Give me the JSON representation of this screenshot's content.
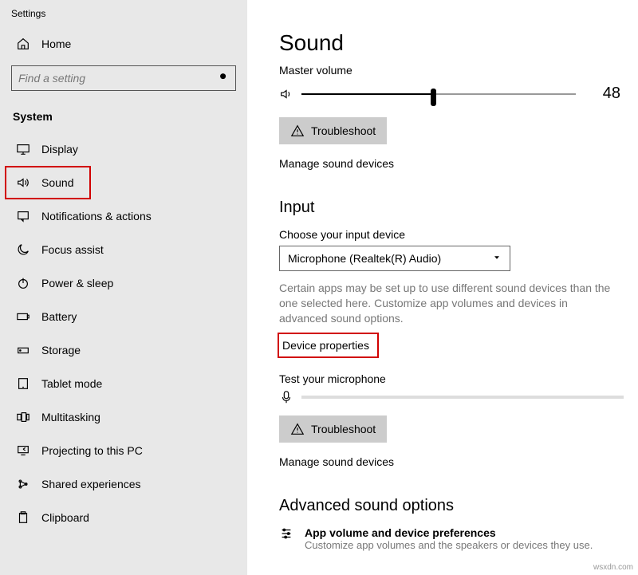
{
  "window_title": "Settings",
  "sidebar": {
    "home": "Home",
    "search_placeholder": "Find a setting",
    "section": "System",
    "items": [
      {
        "label": "Display",
        "icon": "display-icon"
      },
      {
        "label": "Sound",
        "icon": "sound-icon",
        "highlighted": true
      },
      {
        "label": "Notifications & actions",
        "icon": "notifications-icon"
      },
      {
        "label": "Focus assist",
        "icon": "focus-assist-icon"
      },
      {
        "label": "Power & sleep",
        "icon": "power-icon"
      },
      {
        "label": "Battery",
        "icon": "battery-icon"
      },
      {
        "label": "Storage",
        "icon": "storage-icon"
      },
      {
        "label": "Tablet mode",
        "icon": "tablet-icon"
      },
      {
        "label": "Multitasking",
        "icon": "multitasking-icon"
      },
      {
        "label": "Projecting to this PC",
        "icon": "projecting-icon"
      },
      {
        "label": "Shared experiences",
        "icon": "shared-icon"
      },
      {
        "label": "Clipboard",
        "icon": "clipboard-icon"
      }
    ]
  },
  "main": {
    "title": "Sound",
    "master_volume_label": "Master volume",
    "volume_value": "48",
    "troubleshoot": "Troubleshoot",
    "manage_devices": "Manage sound devices",
    "input_heading": "Input",
    "choose_input_label": "Choose your input device",
    "input_device": "Microphone (Realtek(R) Audio)",
    "input_desc": "Certain apps may be set up to use different sound devices than the one selected here. Customize app volumes and devices in advanced sound options.",
    "device_properties": "Device properties",
    "test_mic_label": "Test your microphone",
    "advanced_heading": "Advanced sound options",
    "advanced_item_title": "App volume and device preferences",
    "advanced_item_desc": "Customize app volumes and the speakers or devices they use."
  },
  "watermark": "wsxdn.com"
}
